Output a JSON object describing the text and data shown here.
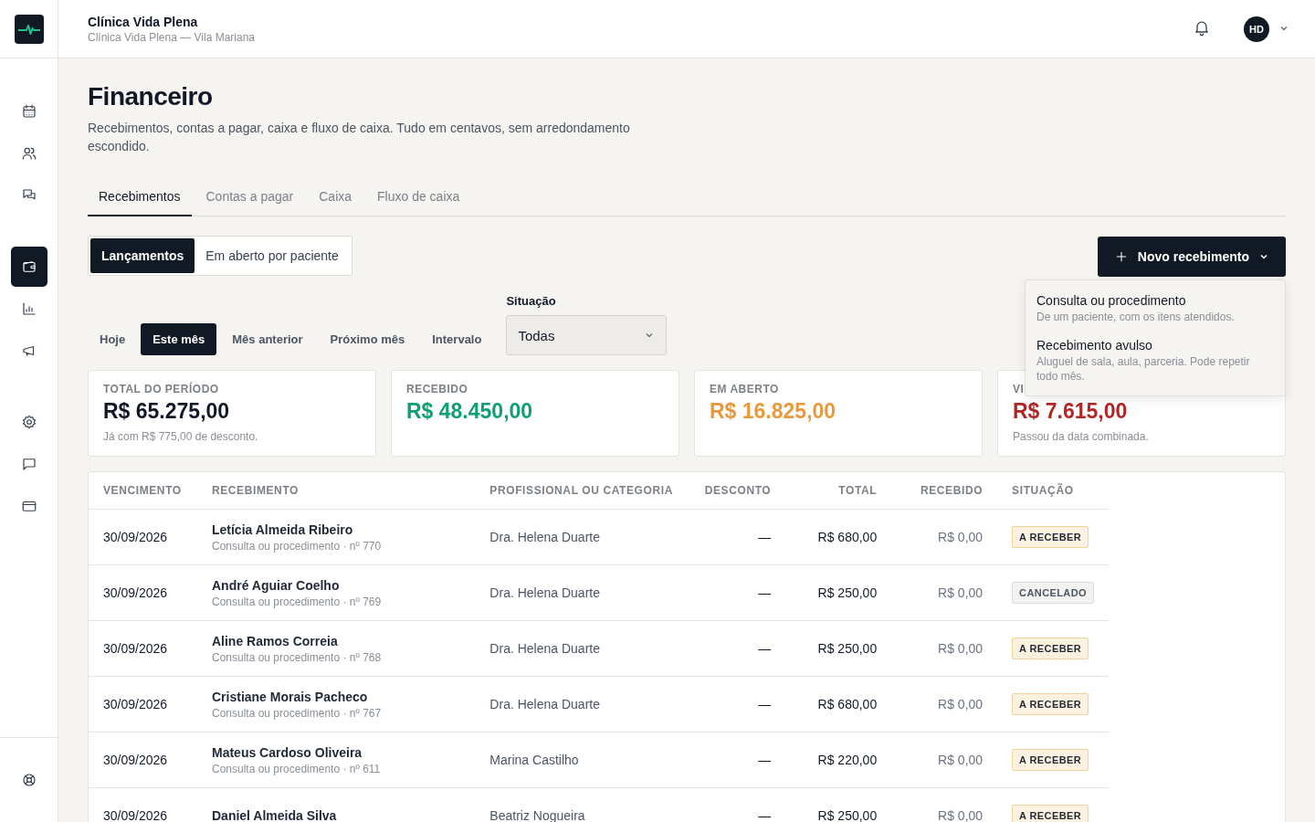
{
  "header": {
    "clinic_name": "Clínica Vida Plena",
    "clinic_unit": "Clínica Vida Plena — Vila Mariana",
    "avatar_initials": "HD"
  },
  "sidebar": {
    "sections": [
      {
        "items": [
          {
            "selected": false
          },
          {
            "selected": false
          },
          {
            "selected": false
          }
        ]
      },
      {
        "items": [
          {
            "selected": true
          },
          {
            "selected": false
          },
          {
            "selected": false
          }
        ]
      },
      {
        "items": [
          {
            "selected": false
          },
          {
            "selected": false
          },
          {
            "selected": false
          }
        ]
      }
    ],
    "footer_items": [
      {
        "selected": false
      }
    ]
  },
  "page": {
    "title": "Financeiro",
    "subtitle": "Recebimentos, contas a pagar, caixa e fluxo de caixa. Tudo em centavos, sem arredondamento escondido."
  },
  "tabs": [
    {
      "label": "Recebimentos",
      "selected": true
    },
    {
      "label": "Contas a pagar",
      "selected": false
    },
    {
      "label": "Caixa",
      "selected": false
    },
    {
      "label": "Fluxo de caixa",
      "selected": false
    }
  ],
  "views": [
    {
      "label": "Lançamentos",
      "selected": true
    },
    {
      "label": "Em aberto por paciente",
      "selected": false
    }
  ],
  "new_button": {
    "label": "Novo recebimento",
    "expanded": true
  },
  "new_menu": [
    {
      "title": "Consulta ou procedimento",
      "description": "De um paciente, com os itens atendidos."
    },
    {
      "title": "Recebimento avulso",
      "description": "Aluguel de sala, aula, parceria. Pode repetir todo mês."
    }
  ],
  "periods": [
    {
      "label": "Hoje",
      "selected": false
    },
    {
      "label": "Este mês",
      "selected": true
    },
    {
      "label": "Mês anterior",
      "selected": false
    },
    {
      "label": "Próximo mês",
      "selected": false
    },
    {
      "label": "Intervalo",
      "selected": false
    }
  ],
  "status_filter": {
    "label": "Situação",
    "value": "Todas"
  },
  "summary_cards": [
    {
      "label": "TOTAL DO PERÍODO",
      "value": "R$ 65.275,00",
      "color": "#111827",
      "note": "Já com R$ 775,00 de desconto."
    },
    {
      "label": "RECEBIDO",
      "value": "R$ 48.450,00",
      "color": "#0f9f74"
    },
    {
      "label": "EM ABERTO",
      "value": "R$ 16.825,00",
      "color": "#e8993c"
    },
    {
      "label": "VI",
      "value": "R$ 7.615,00",
      "color": "#b42626",
      "note": "Passou da data combinada."
    }
  ],
  "table": {
    "columns": [
      "VENCIMENTO",
      "RECEBIMENTO",
      "PROFISSIONAL OU CATEGORIA",
      "DESCONTO",
      "TOTAL",
      "RECEBIDO",
      "SITUAÇÃO"
    ],
    "rows": [
      {
        "due": "30/09/2026",
        "name": "Letícia Almeida Ribeiro",
        "detail": "Consulta ou procedimento · nº 770",
        "professional": "Dra. Helena Duarte",
        "discount": "—",
        "total": "R$ 680,00",
        "received": "R$ 0,00",
        "status": {
          "label": "A RECEBER",
          "kind": "pending"
        }
      },
      {
        "due": "30/09/2026",
        "name": "André Aguiar Coelho",
        "detail": "Consulta ou procedimento · nº 769",
        "professional": "Dra. Helena Duarte",
        "discount": "—",
        "total": "R$ 250,00",
        "received": "R$ 0,00",
        "status": {
          "label": "CANCELADO",
          "kind": "cancelled"
        }
      },
      {
        "due": "30/09/2026",
        "name": "Aline Ramos Correia",
        "detail": "Consulta ou procedimento · nº 768",
        "professional": "Dra. Helena Duarte",
        "discount": "—",
        "total": "R$ 250,00",
        "received": "R$ 0,00",
        "status": {
          "label": "A RECEBER",
          "kind": "pending"
        }
      },
      {
        "due": "30/09/2026",
        "name": "Cristiane Morais Pacheco",
        "detail": "Consulta ou procedimento · nº 767",
        "professional": "Dra. Helena Duarte",
        "discount": "—",
        "total": "R$ 680,00",
        "received": "R$ 0,00",
        "status": {
          "label": "A RECEBER",
          "kind": "pending"
        }
      },
      {
        "due": "30/09/2026",
        "name": "Mateus Cardoso Oliveira",
        "detail": "Consulta ou procedimento · nº 611",
        "professional": "Marina Castilho",
        "discount": "—",
        "total": "R$ 220,00",
        "received": "R$ 0,00",
        "status": {
          "label": "A RECEBER",
          "kind": "pending"
        }
      },
      {
        "due": "30/09/2026",
        "name": "Daniel Almeida Silva",
        "professional": "Beatriz Nogueira",
        "discount": "—",
        "total": "R$ 250,00",
        "received": "R$ 0,00",
        "status": {
          "label": "A RECEBER",
          "kind": "pending"
        }
      }
    ]
  }
}
